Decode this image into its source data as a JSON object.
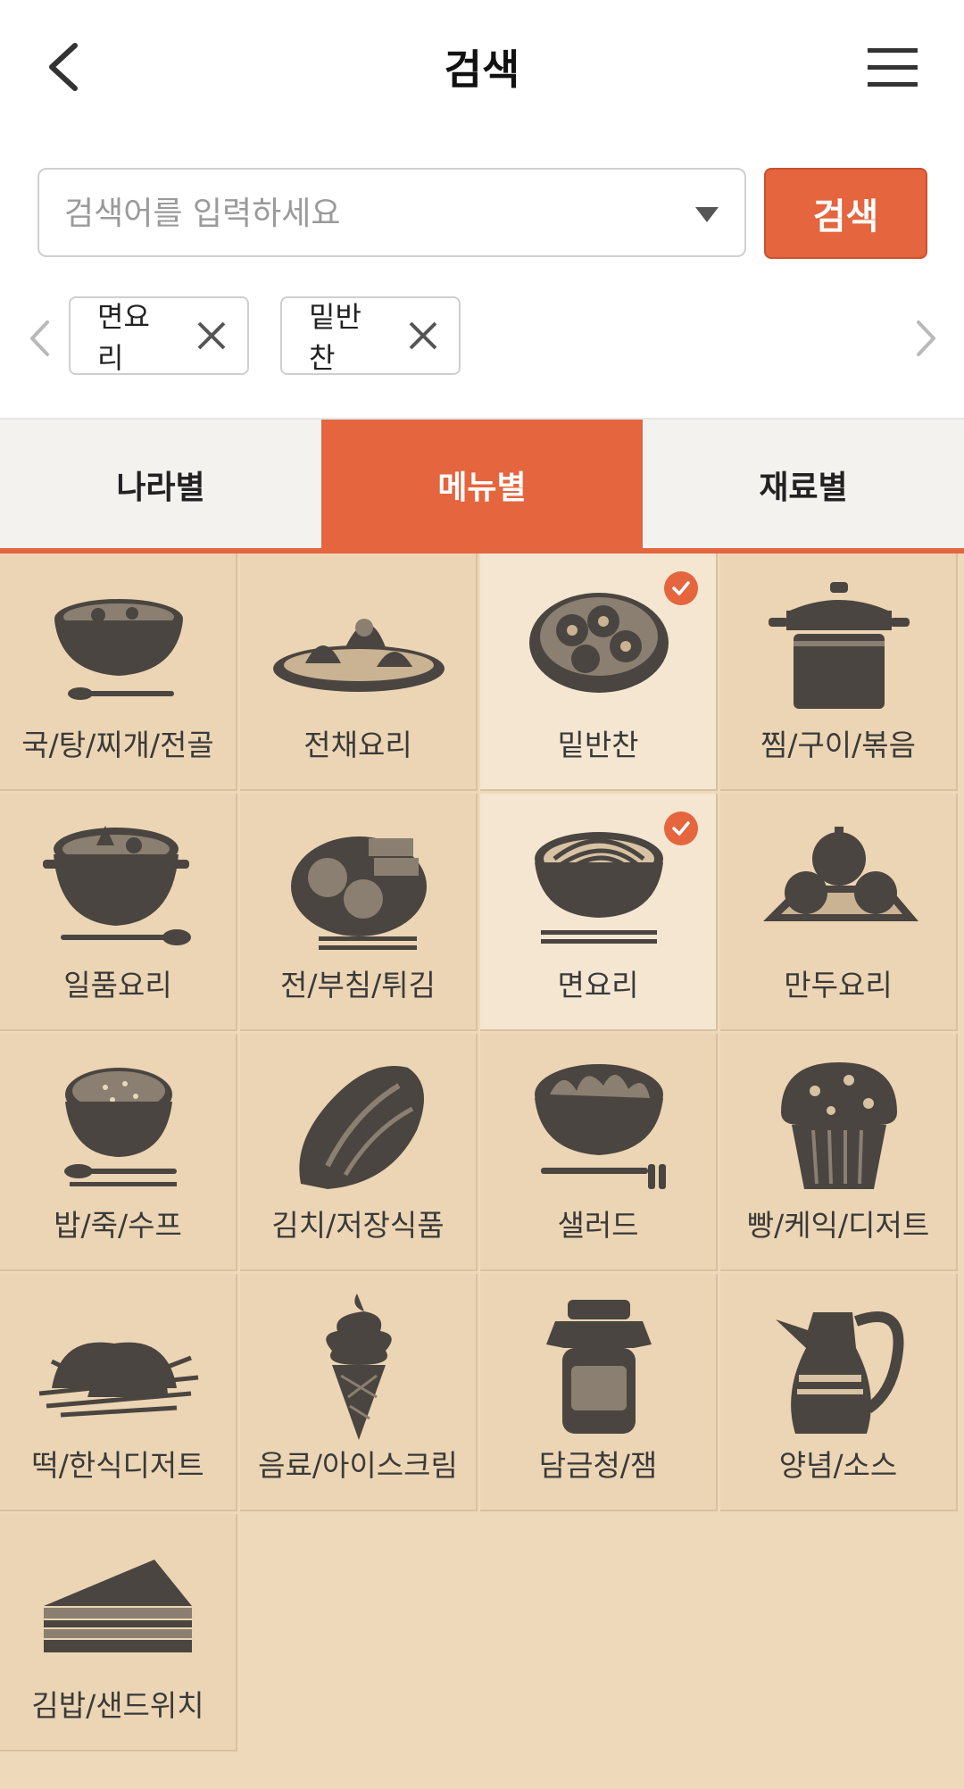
{
  "header": {
    "title": "검색",
    "back_icon": "chevron-left-icon",
    "menu_icon": "hamburger-menu-icon"
  },
  "search": {
    "placeholder": "검색어를 입력하세요",
    "value": "",
    "button_label": "검색"
  },
  "chips": [
    {
      "label": "면요리"
    },
    {
      "label": "밑반찬"
    }
  ],
  "tabs": [
    {
      "label": "나라별",
      "active": false
    },
    {
      "label": "메뉴별",
      "active": true
    },
    {
      "label": "재료별",
      "active": false
    }
  ],
  "categories": [
    {
      "label": "국/탕/찌개/전골",
      "icon": "soup-bowl-icon",
      "selected": false
    },
    {
      "label": "전채요리",
      "icon": "appetizer-plate-icon",
      "selected": false
    },
    {
      "label": "밑반찬",
      "icon": "side-dish-bowl-icon",
      "selected": true
    },
    {
      "label": "찜/구이/볶음",
      "icon": "steamer-pot-icon",
      "selected": false
    },
    {
      "label": "일품요리",
      "icon": "hot-pot-icon",
      "selected": false
    },
    {
      "label": "전/부침/튀김",
      "icon": "fried-food-icon",
      "selected": false
    },
    {
      "label": "면요리",
      "icon": "noodle-bowl-icon",
      "selected": true
    },
    {
      "label": "만두요리",
      "icon": "dumplings-icon",
      "selected": false
    },
    {
      "label": "밥/죽/수프",
      "icon": "rice-bowl-icon",
      "selected": false
    },
    {
      "label": "김치/저장식품",
      "icon": "cabbage-icon",
      "selected": false
    },
    {
      "label": "샐러드",
      "icon": "salad-bowl-icon",
      "selected": false
    },
    {
      "label": "빵/케익/디저트",
      "icon": "muffin-icon",
      "selected": false
    },
    {
      "label": "떡/한식디저트",
      "icon": "rice-cake-icon",
      "selected": false
    },
    {
      "label": "음료/아이스크림",
      "icon": "ice-cream-cone-icon",
      "selected": false
    },
    {
      "label": "담금청/잼",
      "icon": "jam-jar-icon",
      "selected": false
    },
    {
      "label": "양념/소스",
      "icon": "sauce-pitcher-icon",
      "selected": false
    },
    {
      "label": "김밥/샌드위치",
      "icon": "sandwich-icon",
      "selected": false
    }
  ],
  "colors": {
    "accent": "#e4653e",
    "grid_bg": "#ecd5b4",
    "icon": "#4a4540"
  }
}
